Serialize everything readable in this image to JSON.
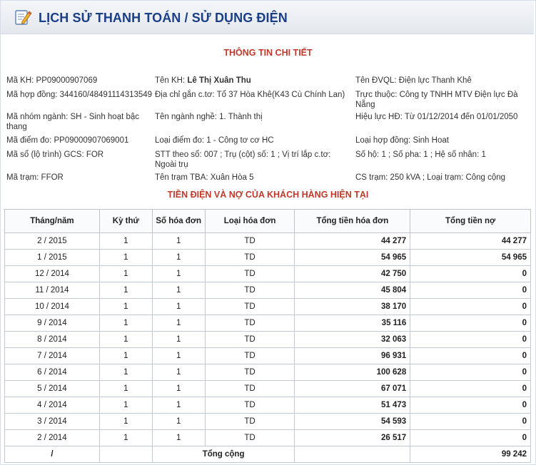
{
  "header": {
    "title": "LỊCH SỬ THANH TOÁN / SỬ DỤNG ĐIỆN"
  },
  "detail_title": "THÔNG TIN CHI TIẾT",
  "info": {
    "r1c1": "Mã KH: PP09000907069",
    "r1c2_label": "Tên KH: ",
    "r1c2_value": "Lê Thị Xuân Thu",
    "r1c3": "Tên ĐVQL: Điện lực Thanh Khê",
    "r2c1": "Mã hợp đồng: 344160/48491114313549",
    "r2c2": "Địa chỉ gắn c.tơ: Tổ 37 Hòa Khê(K43 Cù Chính Lan)",
    "r2c3": "Trực thuộc: Công ty TNHH MTV Điện lực Đà Nẵng",
    "r3c1": "Mã nhóm ngành: SH - Sinh hoạt bậc thang",
    "r3c2": "Tên ngành nghề: 1. Thành thị",
    "r3c3": "Hiệu lực HĐ: Từ 01/12/2014 đến 01/01/2050",
    "r4c1": "Mã điểm đo: PP09000907069001",
    "r4c2": "Loại điểm đo: 1 - Công tơ cơ HC",
    "r4c3": "Loại hợp đồng: Sinh Hoat",
    "r5c1": "Mã sổ (lộ trình) GCS: FOR",
    "r5c2": "STT theo sổ: 007 ; Trụ (cột) số: 1 ; Vị trí lắp c.tơ: Ngoài trụ",
    "r5c3": "Số hộ: 1 ; Số pha: 1 ; Hệ số nhân: 1",
    "r6c1": "Mã trạm: FFOR",
    "r6c2": "Tên trạm TBA: Xuân Hòa 5",
    "r6c3": "CS trạm: 250 kVA ; Loại trạm: Công cộng"
  },
  "debt_title": "TIỀN ĐIỆN VÀ NỢ CỦA KHÁCH HÀNG HIỆN TẠI",
  "table": {
    "headers": [
      "Tháng/năm",
      "Kỳ thứ",
      "Số hóa đơn",
      "Loại hóa đơn",
      "Tổng tiền hóa đơn",
      "Tổng tiền nợ"
    ],
    "rows": [
      [
        "2 / 2015",
        "1",
        "1",
        "TD",
        "44 277",
        "44 277"
      ],
      [
        "1 / 2015",
        "1",
        "1",
        "TD",
        "54 965",
        "54 965"
      ],
      [
        "12 / 2014",
        "1",
        "1",
        "TD",
        "42 750",
        "0"
      ],
      [
        "11 / 2014",
        "1",
        "1",
        "TD",
        "45 804",
        "0"
      ],
      [
        "10 / 2014",
        "1",
        "1",
        "TD",
        "38 170",
        "0"
      ],
      [
        "9 / 2014",
        "1",
        "1",
        "TD",
        "35 116",
        "0"
      ],
      [
        "8 / 2014",
        "1",
        "1",
        "TD",
        "32 063",
        "0"
      ],
      [
        "7 / 2014",
        "1",
        "1",
        "TD",
        "96 931",
        "0"
      ],
      [
        "6 / 2014",
        "1",
        "1",
        "TD",
        "100 628",
        "0"
      ],
      [
        "5 / 2014",
        "1",
        "1",
        "TD",
        "67 071",
        "0"
      ],
      [
        "4 / 2014",
        "1",
        "1",
        "TD",
        "51 473",
        "0"
      ],
      [
        "3 / 2014",
        "1",
        "1",
        "TD",
        "54 593",
        "0"
      ],
      [
        "2 / 2014",
        "1",
        "1",
        "TD",
        "26 517",
        "0"
      ]
    ],
    "total": {
      "month": "/",
      "label": "Tổng cộng",
      "debt": "99 242"
    }
  }
}
